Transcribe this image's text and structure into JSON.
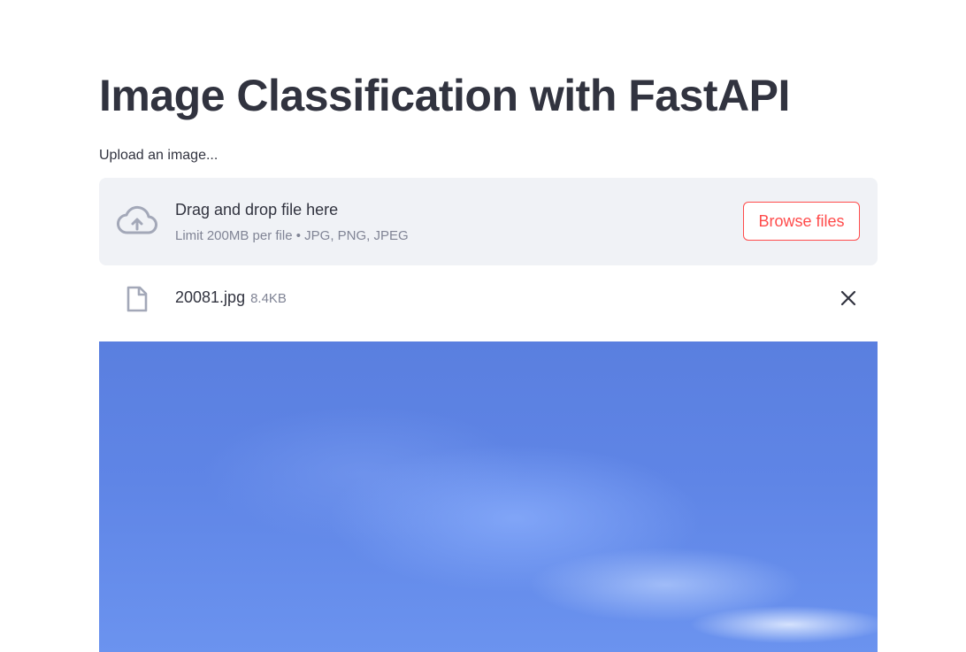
{
  "page": {
    "title": "Image Classification with FastAPI"
  },
  "uploader": {
    "label": "Upload an image...",
    "dropzone_text": "Drag and drop file here",
    "limit_text": "Limit 200MB per file • JPG, PNG, JPEG",
    "browse_label": "Browse files",
    "icon": "cloud-upload-icon"
  },
  "uploaded_file": {
    "name": "20081.jpg",
    "size": "8.4KB",
    "icon": "file-icon",
    "remove_icon": "close-icon"
  },
  "colors": {
    "primary": "#ff4b4b",
    "text": "#31333f",
    "muted": "#808495",
    "dropzone_bg": "#f0f2f6",
    "icon": "#a3a8b8"
  }
}
